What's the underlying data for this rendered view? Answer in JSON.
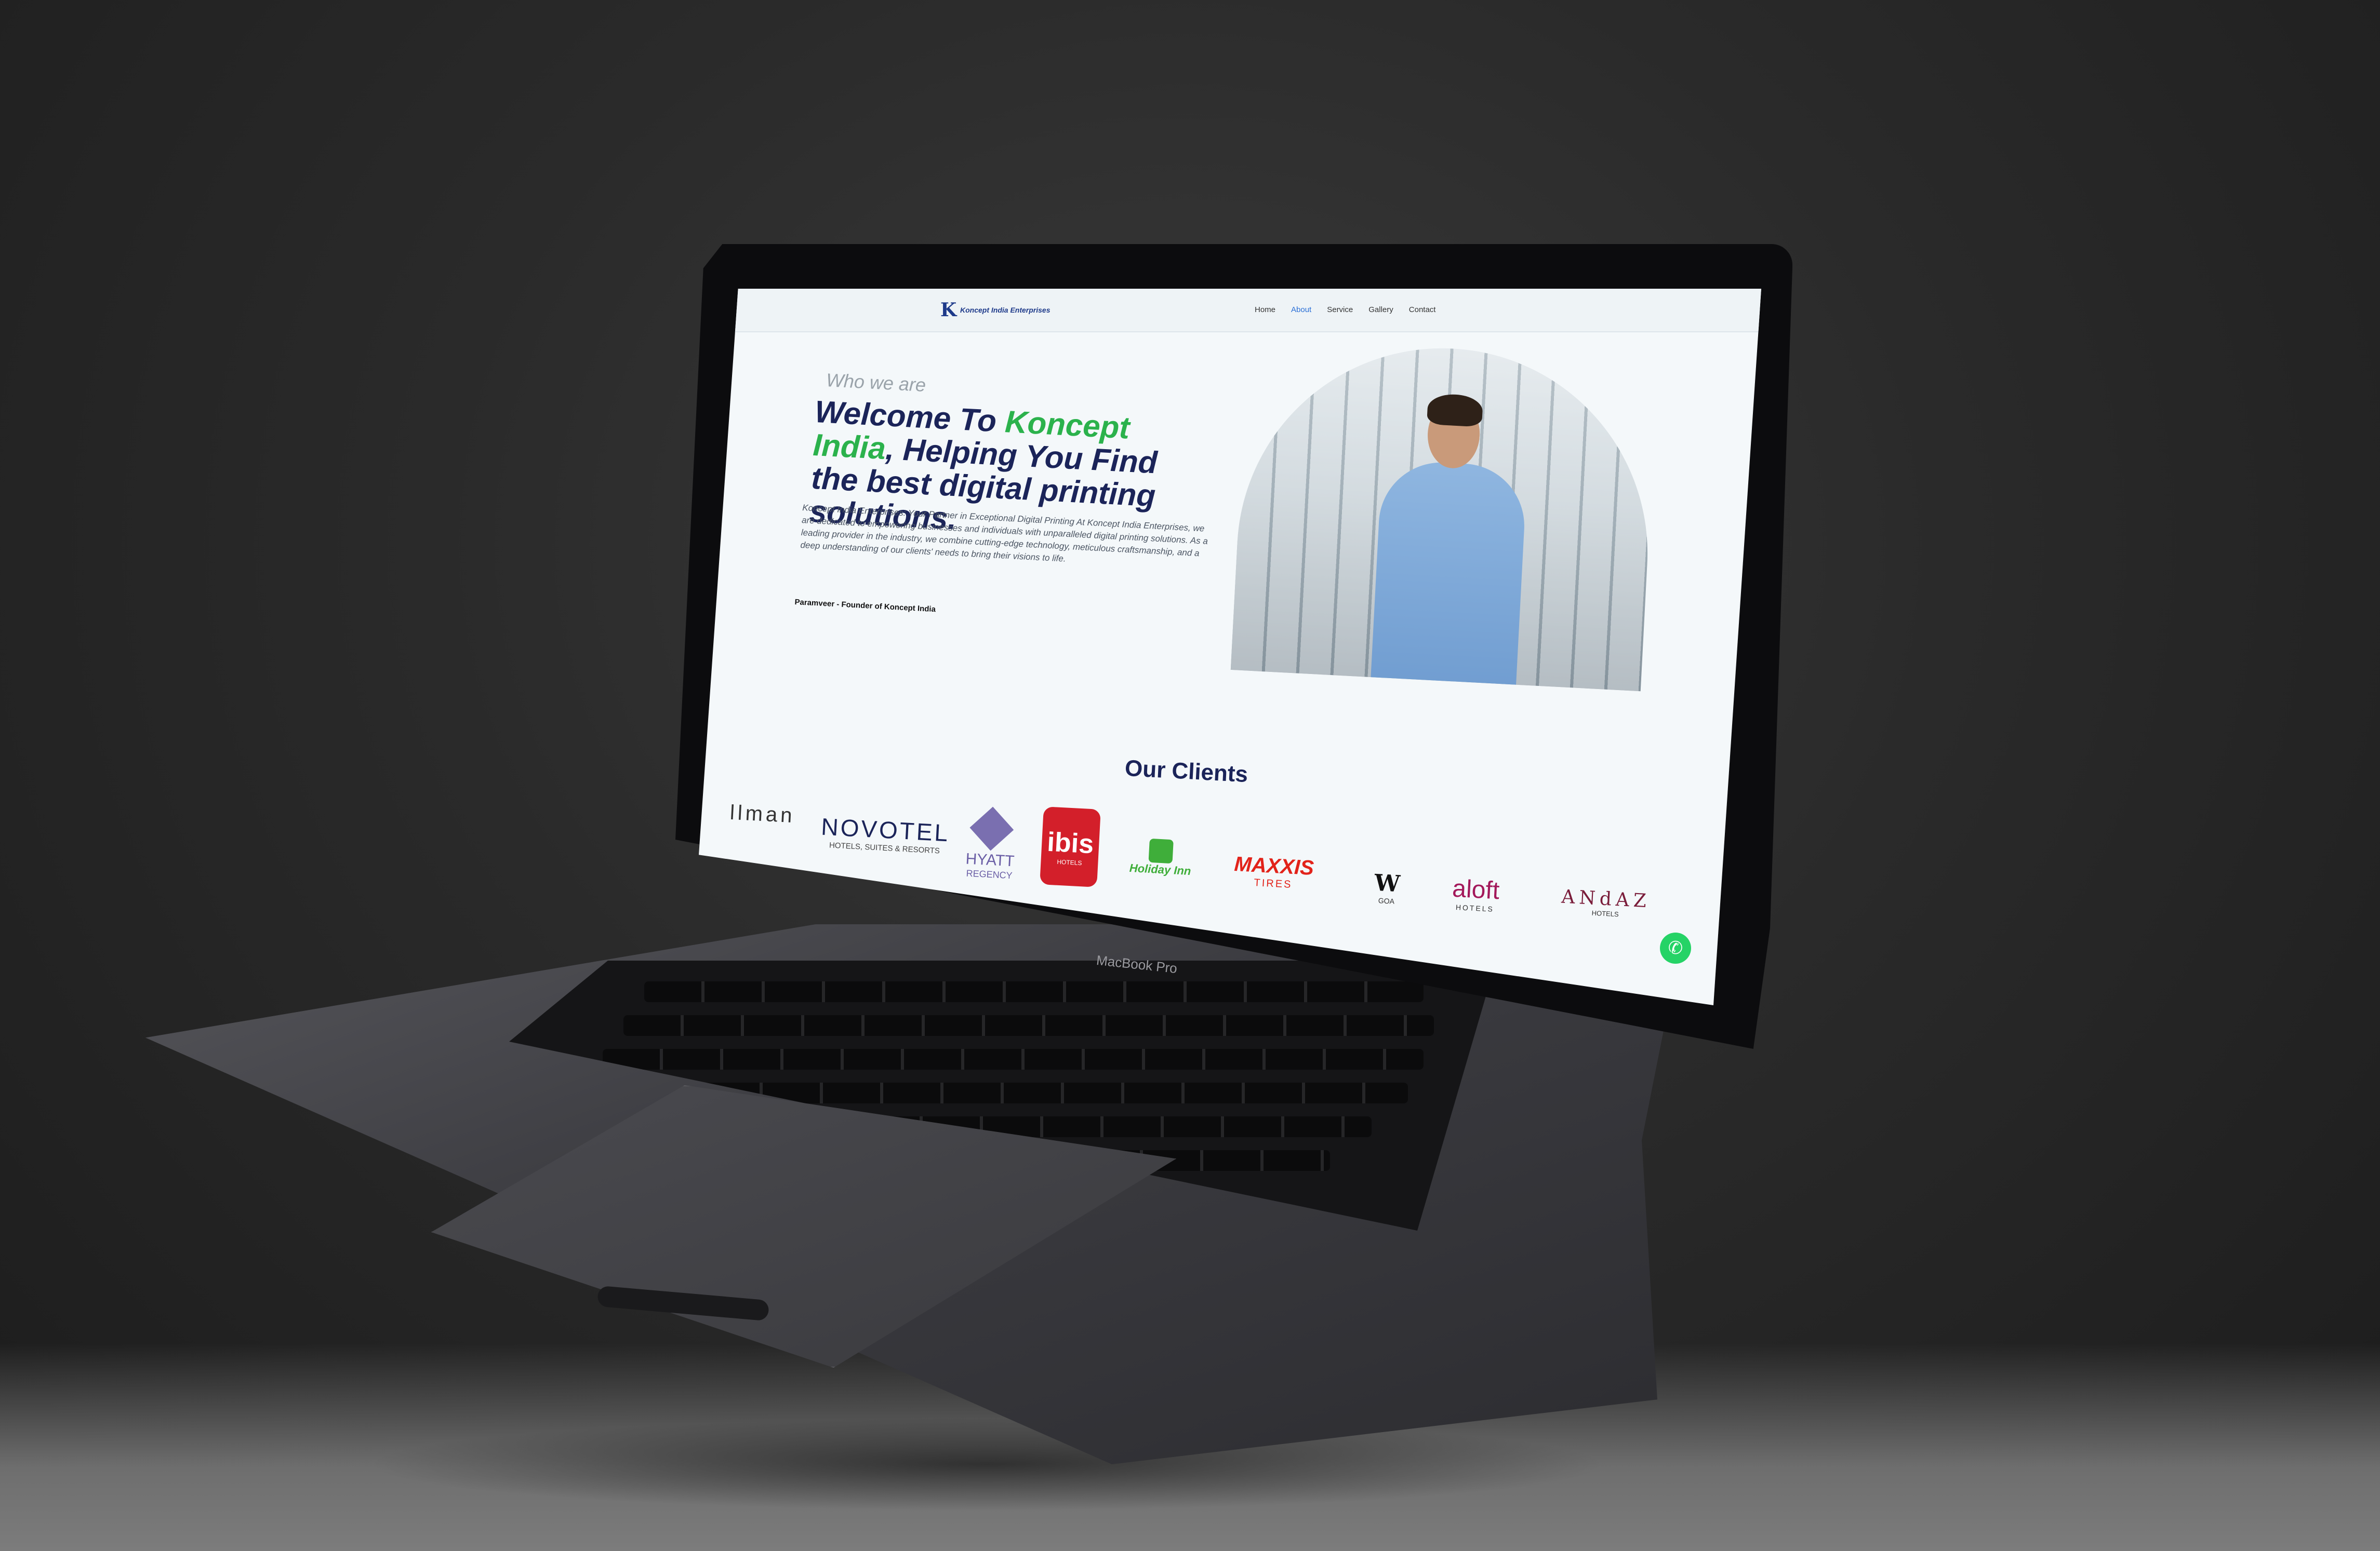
{
  "device": {
    "model_label": "MacBook Pro"
  },
  "site": {
    "brand": "Koncept India Enterprises",
    "logo_letter": "K",
    "nav": [
      {
        "label": "Home",
        "active": false
      },
      {
        "label": "About",
        "active": true
      },
      {
        "label": "Service",
        "active": false
      },
      {
        "label": "Gallery",
        "active": false
      },
      {
        "label": "Contact",
        "active": false
      }
    ],
    "accent_color": "#2a6fd6",
    "brand_green": "#2bb24c",
    "heading_color": "#1b2459"
  },
  "hero": {
    "eyebrow": "Who we are",
    "headline_prefix": "Welcome To ",
    "headline_highlight": "Koncept India",
    "headline_rest": ", Helping You Find the best digital printing solutions.",
    "paragraph": "Koncept India Enterprises: Your Partner in Exceptional Digital Printing At Koncept India Enterprises, we are dedicated to empowering businesses and individuals with unparalleled digital printing solutions. As a leading provider in the industry, we combine cutting-edge technology, meticulous craftsmanship, and a deep understanding of our clients' needs to bring their visions to life.",
    "signature": "Paramveer - Founder of Koncept India"
  },
  "clients": {
    "title": "Our Clients",
    "logos": [
      {
        "name": "llman",
        "sub": ""
      },
      {
        "name": "NOVOTEL",
        "sub": "HOTELS, SUITES & RESORTS"
      },
      {
        "name": "HYATT",
        "sub": "REGENCY"
      },
      {
        "name": "ibis",
        "sub": "HOTELS"
      },
      {
        "name": "Holiday Inn",
        "sub": ""
      },
      {
        "name": "MAXXIS",
        "sub": "TIRES"
      },
      {
        "name": "W",
        "sub": "GOA"
      },
      {
        "name": "aloft",
        "sub": "HOTELS"
      },
      {
        "name": "ANdAZ",
        "sub": "HOTELS"
      }
    ]
  },
  "widgets": {
    "whatsapp_icon": "whatsapp-icon"
  }
}
